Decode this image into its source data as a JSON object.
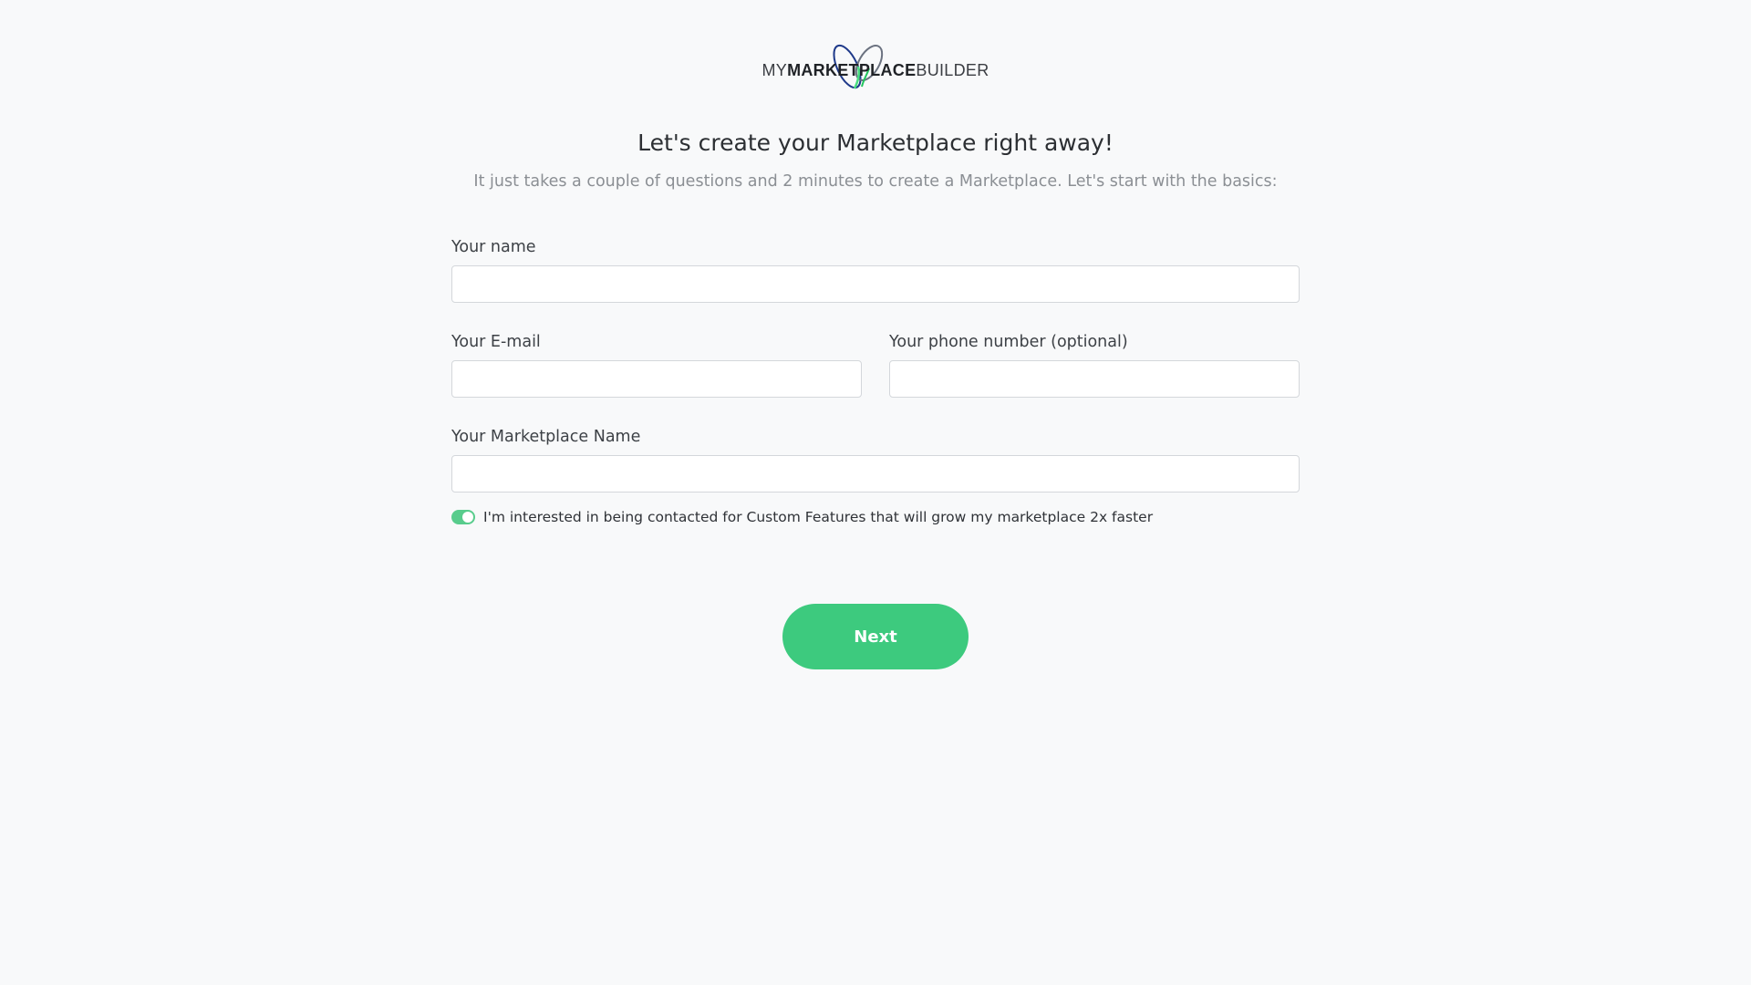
{
  "logo": {
    "prefix": "MY",
    "middle": "MARKETPLACE",
    "suffix": "BUILDER"
  },
  "heading": {
    "title": "Let's create your Marketplace right away!",
    "subtitle": "It just takes a couple of questions and 2 minutes to create a Marketplace. Let's start with the basics:"
  },
  "form": {
    "name": {
      "label": "Your name",
      "value": ""
    },
    "email": {
      "label": "Your E-mail",
      "value": ""
    },
    "phone": {
      "label": "Your phone number (optional)",
      "value": ""
    },
    "marketplace_name": {
      "label": "Your Marketplace Name",
      "value": ""
    },
    "custom_features_toggle": {
      "label": "I'm interested in being contacted for Custom Features that will grow my marketplace 2x faster",
      "checked": true
    }
  },
  "actions": {
    "next_label": "Next"
  },
  "colors": {
    "accent": "#3dca7e",
    "background": "#f8f9fa"
  }
}
